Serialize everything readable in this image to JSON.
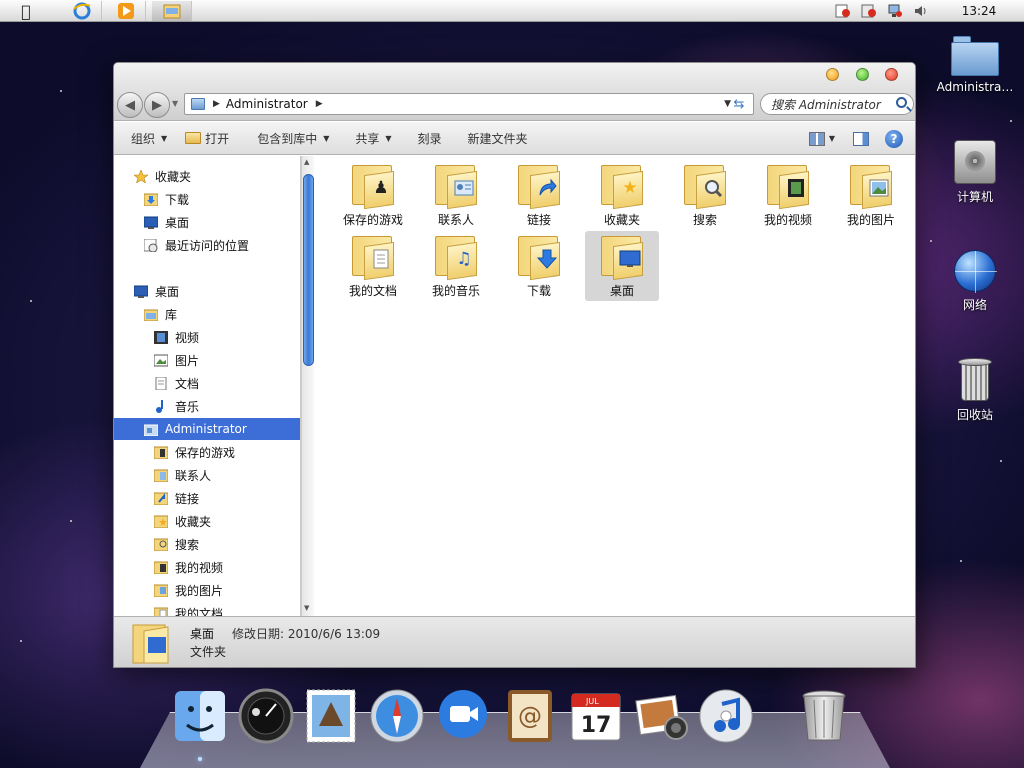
{
  "menubar": {
    "apps": [
      {
        "name": "internet-explorer-icon"
      },
      {
        "name": "media-player-icon"
      },
      {
        "name": "explorer-folder-icon",
        "active": true
      }
    ],
    "clock": "13:24"
  },
  "window": {
    "address": {
      "path": "Administrator"
    },
    "search": {
      "placeholder": "搜索 Administrator"
    },
    "toolbar": {
      "organize": "组织",
      "open": "打开",
      "include_in_library": "包含到库中",
      "share": "共享",
      "burn": "刻录",
      "new_folder": "新建文件夹"
    },
    "sidebar": {
      "favorites": {
        "header": "收藏夹",
        "items": [
          "下载",
          "桌面",
          "最近访问的位置"
        ]
      },
      "desktop": "桌面",
      "libraries": {
        "header": "库",
        "items": [
          "视频",
          "图片",
          "文档",
          "音乐"
        ]
      },
      "user": {
        "label": "Administrator",
        "items": [
          "保存的游戏",
          "联系人",
          "链接",
          "收藏夹",
          "搜索",
          "我的视频",
          "我的图片",
          "我的文档"
        ]
      }
    },
    "files": [
      {
        "label": "保存的游戏",
        "emblem": "chess-icon"
      },
      {
        "label": "联系人",
        "emblem": "contact-card-icon"
      },
      {
        "label": "链接",
        "emblem": "link-arrow-icon"
      },
      {
        "label": "收藏夹",
        "emblem": "star-icon"
      },
      {
        "label": "搜索",
        "emblem": "magnifier-icon"
      },
      {
        "label": "我的视频",
        "emblem": "film-icon"
      },
      {
        "label": "我的图片",
        "emblem": "picture-icon"
      },
      {
        "label": "我的文档",
        "emblem": "document-icon"
      },
      {
        "label": "我的音乐",
        "emblem": "music-note-icon"
      },
      {
        "label": "下载",
        "emblem": "download-arrow-icon"
      },
      {
        "label": "桌面",
        "emblem": "monitor-icon",
        "selected": true
      }
    ],
    "details": {
      "name": "桌面",
      "modified": "修改日期: 2010/6/6 13:09",
      "type": "文件夹"
    }
  },
  "desktop_icons": [
    {
      "label": "Administra…",
      "icon": "user-folder-icon"
    },
    {
      "label": "计算机",
      "icon": "hard-drive-icon"
    },
    {
      "label": "网络",
      "icon": "network-globe-icon"
    },
    {
      "label": "回收站",
      "icon": "recycle-bin-icon"
    }
  ],
  "dock": [
    {
      "name": "finder-icon"
    },
    {
      "name": "dashboard-icon"
    },
    {
      "name": "mail-stamp-icon"
    },
    {
      "name": "safari-compass-icon"
    },
    {
      "name": "video-chat-icon"
    },
    {
      "name": "address-book-icon"
    },
    {
      "name": "calendar-icon",
      "month": "JUL",
      "day": "17"
    },
    {
      "name": "photo-booth-icon"
    },
    {
      "name": "itunes-icon"
    },
    {
      "name": "trash-icon"
    }
  ],
  "colors": {
    "selection": "#3d6ed8",
    "accent": "#2f5d9c"
  }
}
